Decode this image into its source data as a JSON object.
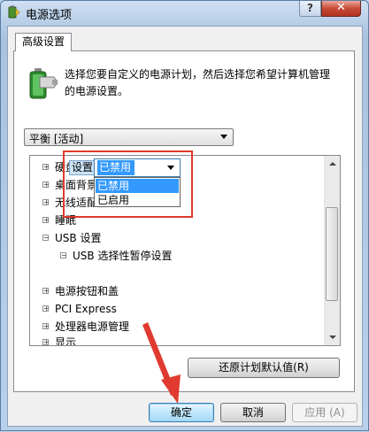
{
  "window": {
    "title": "电源选项",
    "help_label": "?",
    "close_label": "✕"
  },
  "tab": {
    "label": "高级设置"
  },
  "description": "选择您要自定义的电源计划，然后选择您希望计算机管理的电源设置。",
  "plan_select": {
    "value": "平衡 [活动]"
  },
  "tree": {
    "items": [
      {
        "label": "硬盘",
        "expander": "+"
      },
      {
        "label": "桌面背景设置",
        "expander": "+"
      },
      {
        "label": "无线适配器设置",
        "expander": "+"
      },
      {
        "label": "睡眠",
        "expander": "+"
      },
      {
        "label": "USB 设置",
        "expander": "−"
      },
      {
        "label": "USB 选择性暂停设置",
        "expander": "−"
      },
      {
        "label": "电源按钮和盖",
        "expander": "+"
      },
      {
        "label": "PCI Express",
        "expander": "+"
      },
      {
        "label": "处理器电源管理",
        "expander": "+"
      },
      {
        "label": "显示",
        "expander": "+"
      }
    ],
    "setting_label": "设置:",
    "setting_value": "已禁用",
    "options": [
      "已禁用",
      "已启用"
    ]
  },
  "buttons": {
    "restore_defaults": "还原计划默认值(R)",
    "ok": "确定",
    "cancel": "取消",
    "apply": "应用 (A)"
  },
  "colors": {
    "highlight": "#3399ff",
    "annotation": "#e03a30"
  }
}
